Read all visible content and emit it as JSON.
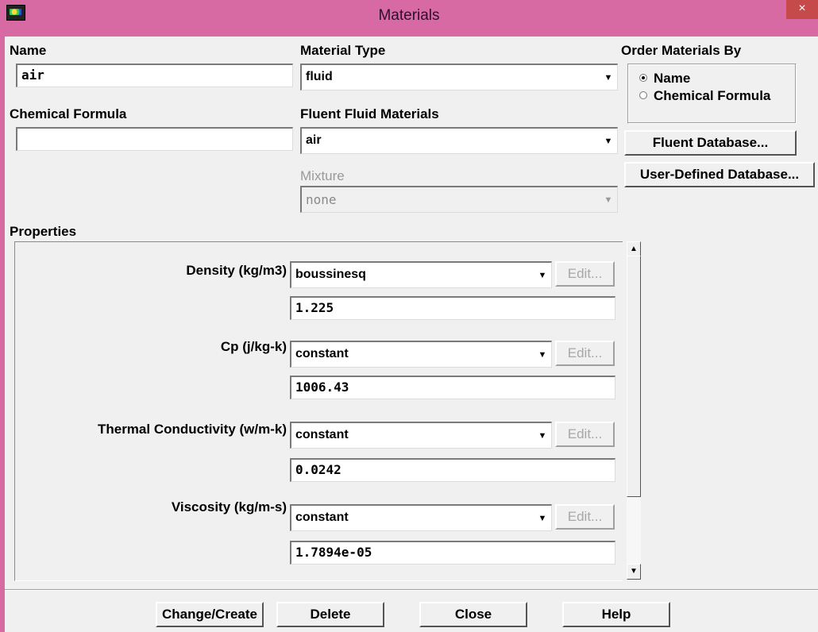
{
  "window": {
    "title": "Materials",
    "close_glyph": "×"
  },
  "name_section": {
    "label": "Name",
    "value": "air"
  },
  "chemical_formula": {
    "label": "Chemical Formula",
    "value": ""
  },
  "material_type": {
    "label": "Material Type",
    "value": "fluid"
  },
  "fluent_fluid_materials": {
    "label": "Fluent Fluid Materials",
    "value": "air"
  },
  "mixture": {
    "label": "Mixture",
    "value": "none"
  },
  "order_by": {
    "label": "Order Materials By",
    "options": [
      {
        "label": "Name",
        "selected": true
      },
      {
        "label": "Chemical Formula",
        "selected": false
      }
    ]
  },
  "database_buttons": {
    "fluent": "Fluent Database...",
    "user_defined": "User-Defined Database..."
  },
  "properties": {
    "label": "Properties",
    "rows": [
      {
        "label": "Density (kg/m3)",
        "method": "boussinesq",
        "edit": "Edit...",
        "value": "1.225"
      },
      {
        "label": "Cp (j/kg-k)",
        "method": "constant",
        "edit": "Edit...",
        "value": "1006.43"
      },
      {
        "label": "Thermal Conductivity (w/m-k)",
        "method": "constant",
        "edit": "Edit...",
        "value": "0.0242"
      },
      {
        "label": "Viscosity (kg/m-s)",
        "method": "constant",
        "edit": "Edit...",
        "value": "1.7894e-05"
      }
    ]
  },
  "footer": {
    "change_create": "Change/Create",
    "delete": "Delete",
    "close": "Close",
    "help": "Help"
  },
  "icons": {
    "dropdown": "chevron-down-icon",
    "scroll_up": "arrow-up-icon",
    "scroll_down": "arrow-down-icon"
  },
  "colors": {
    "titlebar": "#d86aa3",
    "background": "#f0f0f0"
  }
}
